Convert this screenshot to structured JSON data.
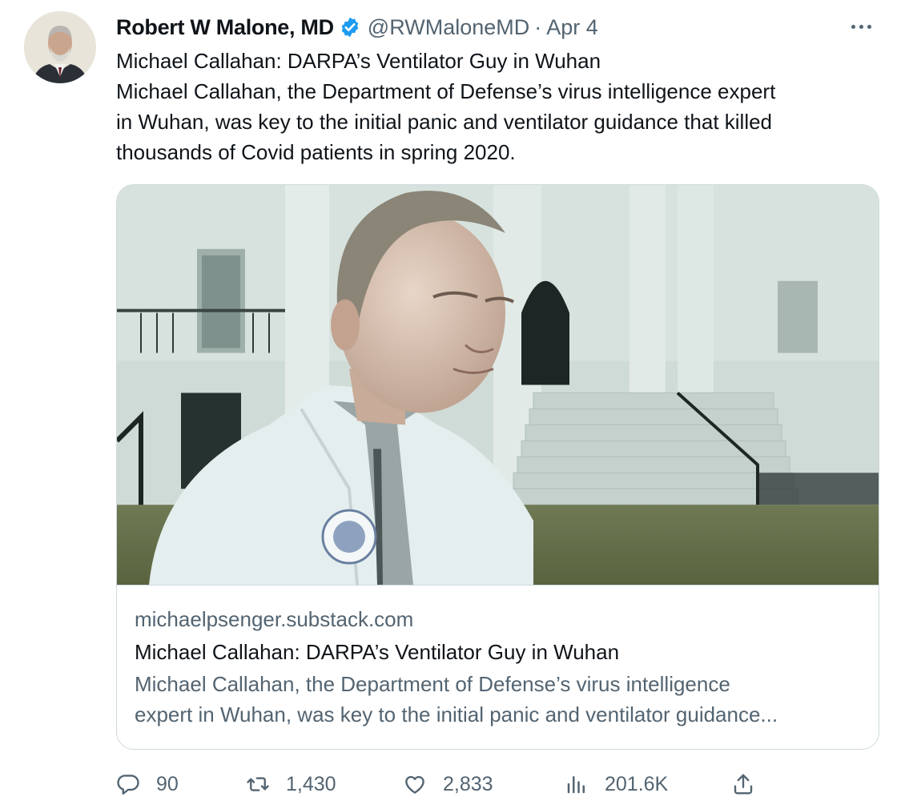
{
  "author": {
    "name": "Robert W Malone, MD",
    "handle": "@RWMaloneMD",
    "separator": "·",
    "date": "Apr 4",
    "verified_color": "#1d9bf0"
  },
  "tweet": {
    "lines": [
      "Michael Callahan: DARPA’s Ventilator Guy in Wuhan",
      "Michael Callahan, the Department of Defense’s virus intelligence expert",
      "in Wuhan, was key to the initial panic and ventilator guidance that killed",
      "thousands of Covid patients in spring 2020."
    ]
  },
  "card": {
    "domain": "michaelpsenger.substack.com",
    "title": "Michael Callahan: DARPA’s Ventilator Guy in Wuhan",
    "description_lines": [
      "Michael Callahan, the Department of Defense’s virus intelligence",
      "expert in Wuhan, was key to the initial panic and ventilator guidance..."
    ]
  },
  "actions": {
    "replies": "90",
    "retweets": "1,430",
    "likes": "2,833",
    "views": "201.6K"
  },
  "icons": {
    "reply": "reply-icon",
    "retweet": "retweet-icon",
    "like": "heart-icon",
    "views": "views-icon",
    "share": "share-icon",
    "more": "more-icon",
    "verified": "verified-badge-icon"
  },
  "colors": {
    "text_primary": "#0f1419",
    "text_secondary": "#536471",
    "border": "#cfd9de",
    "accent": "#1d9bf0"
  }
}
